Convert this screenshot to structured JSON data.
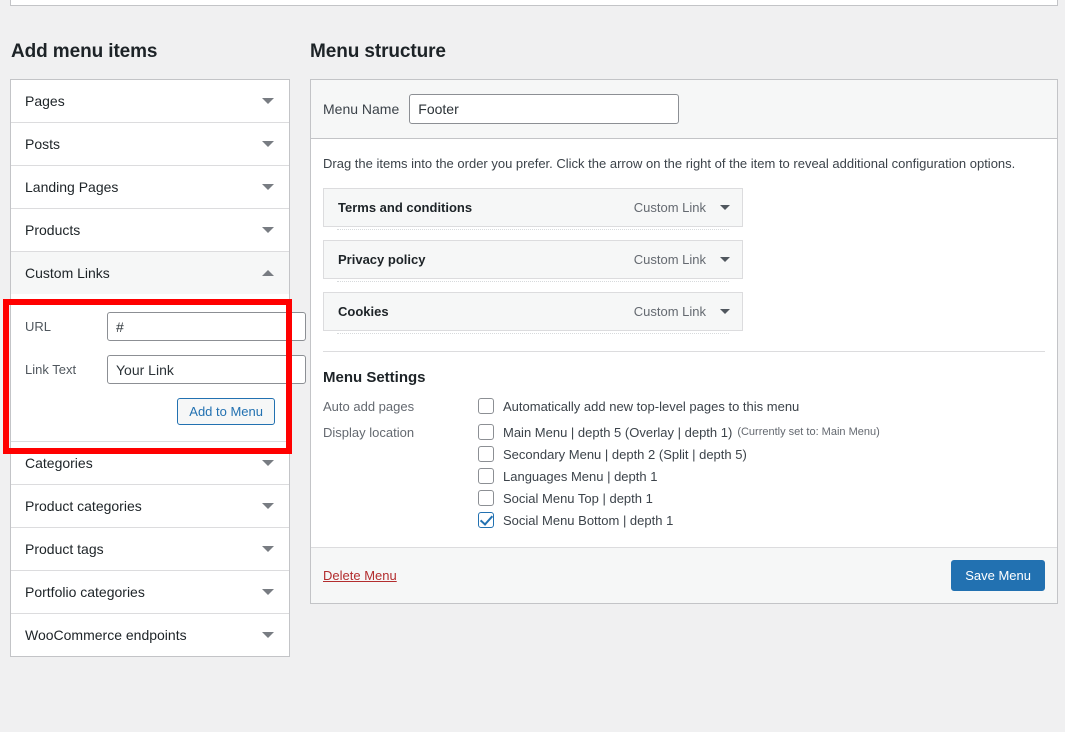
{
  "top_partial_panel": true,
  "add_menu_items": {
    "heading": "Add menu items",
    "panels": [
      {
        "label": "Pages",
        "state": "collapsed",
        "icon": "chevron-down-icon"
      },
      {
        "label": "Posts",
        "state": "collapsed",
        "icon": "chevron-down-icon"
      },
      {
        "label": "Landing Pages",
        "state": "collapsed",
        "icon": "chevron-down-icon"
      },
      {
        "label": "Products",
        "state": "collapsed",
        "icon": "chevron-down-icon"
      },
      {
        "label": "Custom Links",
        "state": "expanded",
        "icon": "chevron-up-icon"
      },
      {
        "label": "Categories",
        "state": "collapsed",
        "icon": "chevron-down-icon"
      },
      {
        "label": "Product categories",
        "state": "collapsed",
        "icon": "chevron-down-icon"
      },
      {
        "label": "Product tags",
        "state": "collapsed",
        "icon": "chevron-down-icon"
      },
      {
        "label": "Portfolio categories",
        "state": "collapsed",
        "icon": "chevron-down-icon"
      },
      {
        "label": "WooCommerce endpoints",
        "state": "collapsed",
        "icon": "chevron-down-icon"
      }
    ],
    "custom_links": {
      "url_label": "URL",
      "url_value": "#",
      "link_text_label": "Link Text",
      "link_text_value": "Your Link",
      "add_button": "Add to Menu"
    }
  },
  "annotation": {
    "color": "#ff0000",
    "target": "custom-links-form"
  },
  "menu_structure": {
    "heading": "Menu structure",
    "menu_name_label": "Menu Name",
    "menu_name_value": "Footer",
    "drag_hint": "Drag the items into the order you prefer. Click the arrow on the right of the item to reveal additional configuration options.",
    "items": [
      {
        "title": "Terms and conditions",
        "type": "Custom Link",
        "icon": "chevron-down-icon"
      },
      {
        "title": "Privacy policy",
        "type": "Custom Link",
        "icon": "chevron-down-icon"
      },
      {
        "title": "Cookies",
        "type": "Custom Link",
        "icon": "chevron-down-icon"
      }
    ],
    "settings": {
      "title": "Menu Settings",
      "auto_add_label": "Auto add pages",
      "auto_add_option": {
        "label": "Automatically add new top-level pages to this menu",
        "checked": false
      },
      "display_location_label": "Display location",
      "locations": [
        {
          "label": "Main Menu | depth 5 (Overlay | depth 1)",
          "note": "(Currently set to: Main Menu)",
          "checked": false
        },
        {
          "label": "Secondary Menu | depth 2 (Split | depth 5)",
          "note": "",
          "checked": false
        },
        {
          "label": "Languages Menu | depth 1",
          "note": "",
          "checked": false
        },
        {
          "label": "Social Menu Top | depth 1",
          "note": "",
          "checked": false
        },
        {
          "label": "Social Menu Bottom | depth 1",
          "note": "",
          "checked": true
        }
      ]
    },
    "footer": {
      "delete_label": "Delete Menu",
      "save_label": "Save Menu",
      "save_color": "#2271b1",
      "delete_color": "#b32d2e"
    }
  }
}
